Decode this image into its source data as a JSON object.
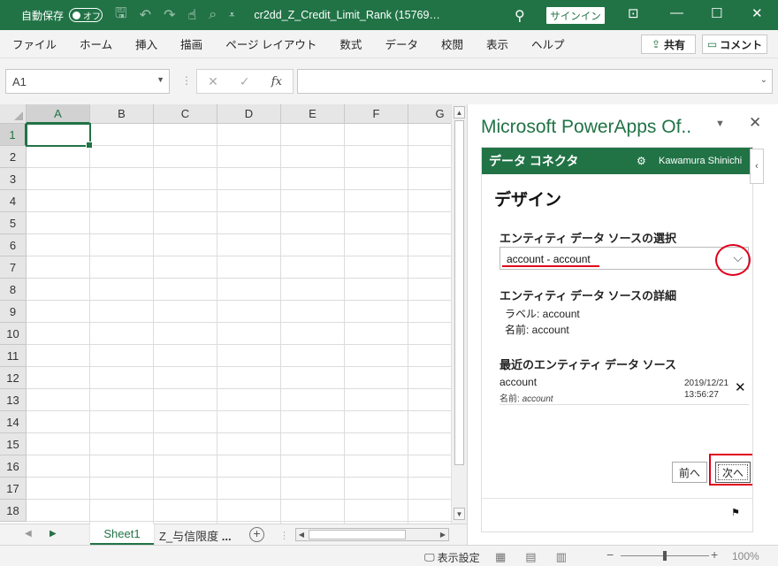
{
  "titlebar": {
    "autosave_label": "自動保存",
    "autosave_state": "オフ",
    "doc_title": "cr2dd_Z_Credit_Limit_Rank (15769…",
    "signin_label": "サインイン"
  },
  "menu": {
    "items": [
      "ファイル",
      "ホーム",
      "挿入",
      "描画",
      "ページ レイアウト",
      "数式",
      "データ",
      "校閲",
      "表示",
      "ヘルプ"
    ],
    "share_label": "共有",
    "comment_label": "コメント"
  },
  "formula_bar": {
    "name_box": "A1",
    "fx_label": "fx",
    "value": ""
  },
  "grid": {
    "columns": [
      "A",
      "B",
      "C",
      "D",
      "E",
      "F",
      "G"
    ],
    "rows": [
      "1",
      "2",
      "3",
      "4",
      "5",
      "6",
      "7",
      "8",
      "9",
      "10",
      "11",
      "12",
      "13",
      "14",
      "15",
      "16",
      "17",
      "18"
    ],
    "active_cell": "A1"
  },
  "sheets": {
    "tabs": [
      "Sheet1",
      "Z_与信限度"
    ],
    "more": "...",
    "active": "Sheet1"
  },
  "status": {
    "display_settings": "表示設定",
    "zoom": "100%"
  },
  "pane": {
    "title": "Microsoft PowerApps Of..",
    "header_title": "データ コネクタ",
    "user": "Kawamura Shinichi",
    "design_title": "デザイン",
    "select_section": "エンティティ データ ソースの選択",
    "selected_value": "account - account",
    "detail_section": "エンティティ データ ソースの詳細",
    "detail_label": "ラベル: account",
    "detail_name": "名前: account",
    "recent_section": "最近のエンティティ データ ソース",
    "recent": {
      "name": "account",
      "sub_prefix": "名前: ",
      "sub_value": "account",
      "date": "2019/12/21",
      "time": "13:56:27"
    },
    "prev_label": "前へ",
    "next_label": "次へ"
  },
  "colors": {
    "excel_green": "#217346",
    "highlight_red": "#e0001b"
  }
}
